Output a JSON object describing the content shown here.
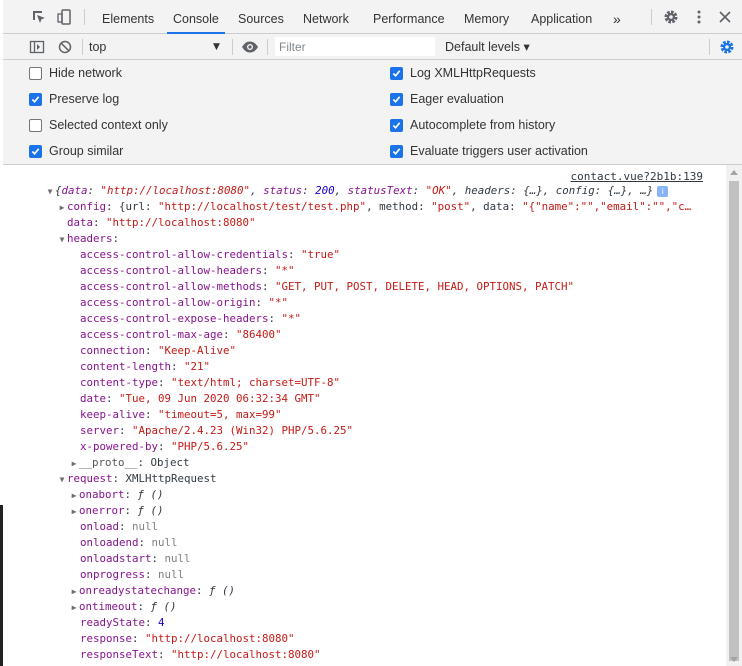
{
  "tabs": [
    {
      "label": "Elements"
    },
    {
      "label": "Console"
    },
    {
      "label": "Sources"
    },
    {
      "label": "Network"
    },
    {
      "label": "Performance"
    },
    {
      "label": "Memory"
    },
    {
      "label": "Application"
    }
  ],
  "tabs_overflow": "»",
  "toolbar": {
    "context": "top",
    "filter_placeholder": "Filter",
    "levels": "Default levels ▾"
  },
  "settings": {
    "left": [
      {
        "label": "Hide network",
        "checked": false
      },
      {
        "label": "Preserve log",
        "checked": true
      },
      {
        "label": "Selected context only",
        "checked": false
      },
      {
        "label": "Group similar",
        "checked": true
      }
    ],
    "right": [
      {
        "label": "Log XMLHttpRequests",
        "checked": true
      },
      {
        "label": "Eager evaluation",
        "checked": true
      },
      {
        "label": "Autocomplete from history",
        "checked": true
      },
      {
        "label": "Evaluate triggers user activation",
        "checked": true
      }
    ]
  },
  "console": {
    "source": "contact.vue?2b1b:139",
    "summary": {
      "data": "\"http://localhost:8080\"",
      "status": "200",
      "statusText": "\"OK\"",
      "rest": ", headers: {…}, config: {…}, …}"
    },
    "config_line": {
      "key": "config",
      "value": "{url: ",
      "url": "\"http://localhost/test/test.php\"",
      "mid": ", method: ",
      "method": "\"post\"",
      "mid2": ", data: ",
      "data": "\"{\"name\":\"\",\"email\":\"\",\"c…"
    },
    "data_line": {
      "key": "data",
      "value": "\"http://localhost:8080\""
    },
    "headers_key": "headers",
    "headers": [
      {
        "k": "access-control-allow-credentials",
        "v": "\"true\""
      },
      {
        "k": "access-control-allow-headers",
        "v": "\"*\""
      },
      {
        "k": "access-control-allow-methods",
        "v": "\"GET, PUT, POST, DELETE, HEAD, OPTIONS, PATCH\""
      },
      {
        "k": "access-control-allow-origin",
        "v": "\"*\""
      },
      {
        "k": "access-control-expose-headers",
        "v": "\"*\""
      },
      {
        "k": "access-control-max-age",
        "v": "\"86400\""
      },
      {
        "k": "connection",
        "v": "\"Keep-Alive\""
      },
      {
        "k": "content-length",
        "v": "\"21\""
      },
      {
        "k": "content-type",
        "v": "\"text/html; charset=UTF-8\""
      },
      {
        "k": "date",
        "v": "\"Tue, 09 Jun 2020 06:32:34 GMT\""
      },
      {
        "k": "keep-alive",
        "v": "\"timeout=5, max=99\""
      },
      {
        "k": "server",
        "v": "\"Apache/2.4.23 (Win32) PHP/5.6.25\""
      },
      {
        "k": "x-powered-by",
        "v": "\"PHP/5.6.25\""
      }
    ],
    "proto": {
      "k": "__proto__",
      "v": "Object"
    },
    "request": {
      "k": "request",
      "v": "XMLHttpRequest"
    },
    "request_props": [
      {
        "k": "onabort",
        "v": "ƒ ()",
        "expand": true,
        "kind": "fn"
      },
      {
        "k": "onerror",
        "v": "ƒ ()",
        "expand": true,
        "kind": "fn"
      },
      {
        "k": "onload",
        "v": "null",
        "expand": false,
        "kind": "null"
      },
      {
        "k": "onloadend",
        "v": "null",
        "expand": false,
        "kind": "null"
      },
      {
        "k": "onloadstart",
        "v": "null",
        "expand": false,
        "kind": "null"
      },
      {
        "k": "onprogress",
        "v": "null",
        "expand": false,
        "kind": "null"
      },
      {
        "k": "onreadystatechange",
        "v": "ƒ ()",
        "expand": true,
        "kind": "fn"
      },
      {
        "k": "ontimeout",
        "v": "ƒ ()",
        "expand": true,
        "kind": "fn"
      },
      {
        "k": "readyState",
        "v": "4",
        "expand": false,
        "kind": "num"
      },
      {
        "k": "response",
        "v": "\"http://localhost:8080\"",
        "expand": false,
        "kind": "str"
      },
      {
        "k": "responseText",
        "v": "\"http://localhost:8080\"",
        "expand": false,
        "kind": "str"
      }
    ]
  },
  "colors": {
    "accent": "#1a73e8",
    "key": "#881391",
    "string": "#c41a16",
    "number": "#1c00cf"
  }
}
